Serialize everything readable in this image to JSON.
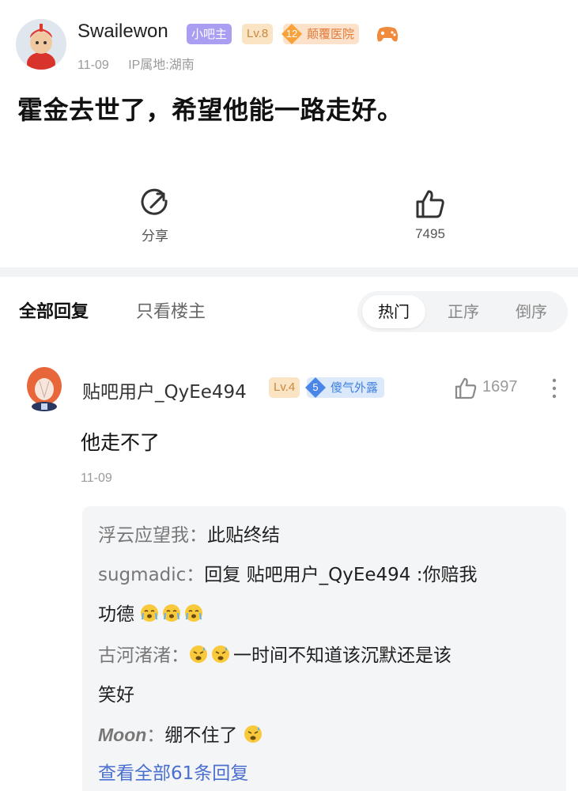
{
  "post": {
    "author": {
      "name": "Swailewon",
      "owner_badge": "小吧主",
      "level_badge": "Lv.8",
      "honor_level": "12",
      "honor_title": "颠覆医院"
    },
    "date": "11-09",
    "ip_location": "IP属地:湖南",
    "title": "霍金去世了，希望他能一路走好。",
    "actions": {
      "share_label": "分享",
      "like_count": "7495"
    }
  },
  "replies_header": {
    "tab_all": "全部回复",
    "tab_owner_only": "只看楼主",
    "sort_options": [
      "热门",
      "正序",
      "倒序"
    ],
    "sort_selected": "热门"
  },
  "comment": {
    "author": "贴吧用户_QyEe494",
    "level_badge": "Lv.4",
    "honor_level": "5",
    "honor_title": "傻气外露",
    "like_count": "1697",
    "text": "他走不了",
    "date": "11-09"
  },
  "sub_replies": [
    {
      "name": "浮云应望我",
      "sep": "：",
      "text": "此贴终结"
    },
    {
      "name": "sugmadic",
      "sep": "：",
      "text_line1": "回复 贴吧用户_QyEe494 :你赔我",
      "text_line2": "功德"
    },
    {
      "name": "古河渚渚",
      "sep": "：",
      "text_line1": "一时间不知道该沉默还是该",
      "text_line2": "笑好"
    },
    {
      "name": "Moon",
      "sep": "：",
      "text": "绷不住了"
    }
  ],
  "view_all_label": "查看全部61条回复",
  "colors": {
    "owner_badge_bg": "#a99ef2",
    "level_badge_bg": "#fbe4c4",
    "level_badge_text": "#c7883f",
    "honor_orange": "#f7a23b",
    "honor_blue": "#4a86e8",
    "link_blue": "#4a6fcf"
  },
  "icons": [
    "share-icon",
    "thumbs-up-icon",
    "more-vertical-icon",
    "game-controller-icon",
    "emoji-crying-icon",
    "emoji-sweat-icon"
  ]
}
